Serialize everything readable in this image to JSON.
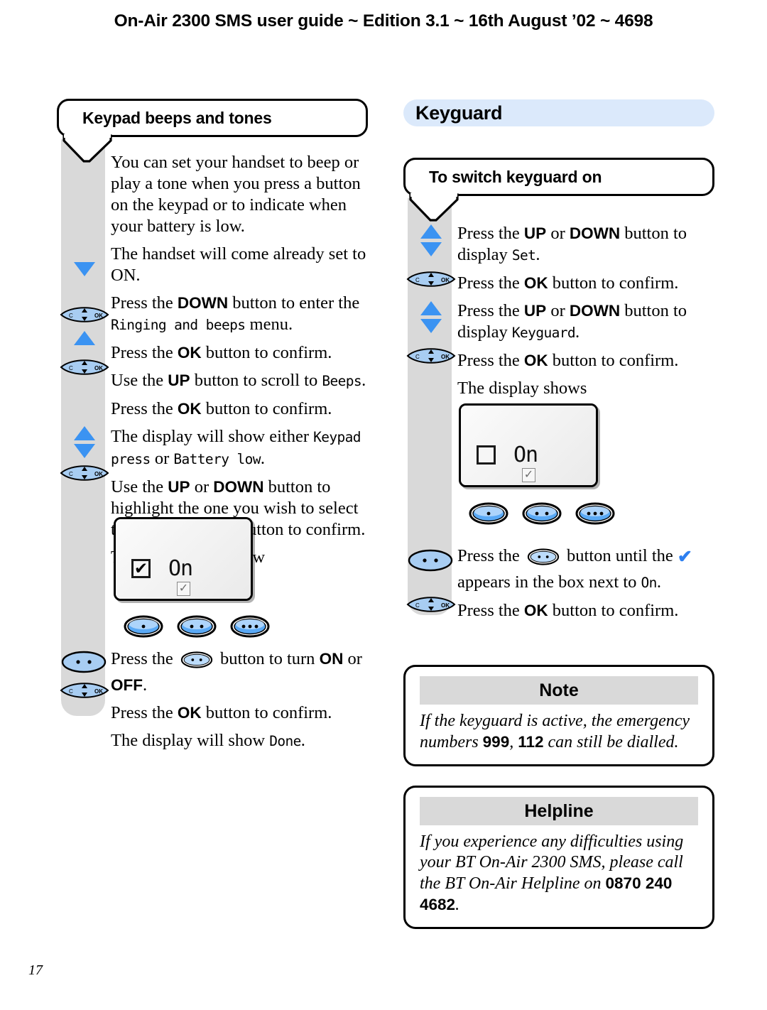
{
  "header": {
    "running_head": "On-Air 2300 SMS user guide ~ Edition 3.1 ~ 16th August ’02 ~ 4698",
    "page_number": "17"
  },
  "colors": {
    "section_bar": "#dbe9fb",
    "spine_grey": "#d9d9d9",
    "arrow_blue": "#3b93f2",
    "key_blue": "#a8cdf2",
    "tick_blue": "#2d7ff0",
    "infobox_bar": "#d9d9d9"
  },
  "left_column": {
    "heading": "Keypad beeps and tones",
    "steps": [
      {
        "icon": "none",
        "parts": [
          {
            "t": "plain",
            "v": "You can set your handset to beep or play a tone when you press a button on the keypad or to indicate when your battery is low."
          }
        ]
      },
      {
        "icon": "none",
        "parts": [
          {
            "t": "plain",
            "v": "The handset will come already set to ON."
          }
        ]
      },
      {
        "icon": "down-arrow",
        "parts": [
          {
            "t": "plain",
            "v": "Press the "
          },
          {
            "t": "bold",
            "v": "DOWN"
          },
          {
            "t": "plain",
            "v": " button to enter the "
          },
          {
            "t": "lcd",
            "v": "Ringing and beeps"
          },
          {
            "t": "plain",
            "v": " menu."
          }
        ]
      },
      {
        "icon": "nav-key",
        "parts": [
          {
            "t": "plain",
            "v": "Press the "
          },
          {
            "t": "bold",
            "v": "OK"
          },
          {
            "t": "plain",
            "v": " button to confirm."
          }
        ]
      },
      {
        "icon": "up-arrow",
        "parts": [
          {
            "t": "plain",
            "v": "Use the "
          },
          {
            "t": "bold",
            "v": "UP"
          },
          {
            "t": "plain",
            "v": " button to scroll to "
          },
          {
            "t": "lcd",
            "v": "Beeps"
          },
          {
            "t": "plain",
            "v": "."
          }
        ]
      },
      {
        "icon": "nav-key",
        "parts": [
          {
            "t": "plain",
            "v": "Press the "
          },
          {
            "t": "bold",
            "v": "OK"
          },
          {
            "t": "plain",
            "v": " button to confirm."
          }
        ]
      },
      {
        "icon": "none",
        "parts": [
          {
            "t": "plain",
            "v": "The display will show either "
          },
          {
            "t": "lcd",
            "v": "Keypad press"
          },
          {
            "t": "plain",
            "v": " or "
          },
          {
            "t": "lcd",
            "v": "Battery low"
          },
          {
            "t": "plain",
            "v": "."
          }
        ]
      },
      {
        "icon": "up-down-nav",
        "parts": [
          {
            "t": "plain",
            "v": "Use the "
          },
          {
            "t": "bold",
            "v": "UP"
          },
          {
            "t": "plain",
            "v": " or "
          },
          {
            "t": "bold",
            "v": "DOWN"
          },
          {
            "t": "plain",
            "v": " button to highlight the one you wish to select then press the "
          },
          {
            "t": "bold",
            "v": "OK"
          },
          {
            "t": "plain",
            "v": " button to confirm."
          }
        ]
      },
      {
        "icon": "none",
        "parts": [
          {
            "t": "plain",
            "v": "The display will show"
          }
        ]
      }
    ],
    "lcd": {
      "checkbox_state": "checked",
      "checkbox_glyph": "✔",
      "value": "On",
      "secondary_checkbox_glyph": "✓"
    },
    "keyrow": [
      {
        "name": "softkey-1-dot",
        "dots": 1
      },
      {
        "name": "softkey-2-dot",
        "dots": 2
      },
      {
        "name": "softkey-3-dot",
        "dots": 3
      }
    ],
    "steps_after": [
      {
        "icon": "soft-key-2dot",
        "parts": [
          {
            "t": "plain",
            "v": "Press the "
          },
          {
            "t": "inline-softkey",
            "v": "2"
          },
          {
            "t": "plain",
            "v": " button to turn "
          },
          {
            "t": "bold",
            "v": "ON"
          },
          {
            "t": "plain",
            "v": " or "
          },
          {
            "t": "bold",
            "v": "OFF"
          },
          {
            "t": "plain",
            "v": "."
          }
        ]
      },
      {
        "icon": "nav-key",
        "parts": [
          {
            "t": "plain",
            "v": "Press the "
          },
          {
            "t": "bold",
            "v": "OK"
          },
          {
            "t": "plain",
            "v": " button to confirm."
          }
        ]
      },
      {
        "icon": "none",
        "parts": [
          {
            "t": "plain",
            "v": "The display will show "
          },
          {
            "t": "lcd",
            "v": "Done"
          },
          {
            "t": "plain",
            "v": "."
          }
        ]
      }
    ]
  },
  "right_column": {
    "section_title": "Keyguard",
    "heading": "To switch keyguard on",
    "steps": [
      {
        "icon": "up-down-arrow",
        "parts": [
          {
            "t": "plain",
            "v": "Press the "
          },
          {
            "t": "bold",
            "v": "UP"
          },
          {
            "t": "plain",
            "v": " or "
          },
          {
            "t": "bold",
            "v": "DOWN"
          },
          {
            "t": "plain",
            "v": " button to display "
          },
          {
            "t": "lcd",
            "v": "Set"
          },
          {
            "t": "plain",
            "v": "."
          }
        ]
      },
      {
        "icon": "nav-key",
        "parts": [
          {
            "t": "plain",
            "v": "Press the "
          },
          {
            "t": "bold",
            "v": "OK"
          },
          {
            "t": "plain",
            "v": " button to confirm."
          }
        ]
      },
      {
        "icon": "up-down-arrow",
        "parts": [
          {
            "t": "plain",
            "v": "Press the "
          },
          {
            "t": "bold",
            "v": "UP"
          },
          {
            "t": "plain",
            "v": " or "
          },
          {
            "t": "bold",
            "v": "DOWN"
          },
          {
            "t": "plain",
            "v": " button to display "
          },
          {
            "t": "lcd",
            "v": "Keyguard"
          },
          {
            "t": "plain",
            "v": "."
          }
        ]
      },
      {
        "icon": "nav-key",
        "parts": [
          {
            "t": "plain",
            "v": "Press the "
          },
          {
            "t": "bold",
            "v": "OK"
          },
          {
            "t": "plain",
            "v": " button to confirm."
          }
        ]
      },
      {
        "icon": "none",
        "parts": [
          {
            "t": "plain",
            "v": "The display shows"
          }
        ]
      }
    ],
    "lcd": {
      "checkbox_state": "empty",
      "checkbox_glyph": "",
      "value": "On",
      "secondary_checkbox_glyph": "✓"
    },
    "keyrow": [
      {
        "name": "softkey-1-dot",
        "dots": 1
      },
      {
        "name": "softkey-2-dot",
        "dots": 2
      },
      {
        "name": "softkey-3-dot",
        "dots": 3
      }
    ],
    "steps_after": [
      {
        "icon": "soft-key-2dot",
        "parts": [
          {
            "t": "plain",
            "v": "Press the "
          },
          {
            "t": "inline-softkey",
            "v": "2"
          },
          {
            "t": "plain",
            "v": " button until the "
          },
          {
            "t": "tick",
            "v": "✔"
          },
          {
            "t": "plain",
            "v": " appears in the box next to "
          },
          {
            "t": "lcd",
            "v": "On"
          },
          {
            "t": "plain",
            "v": "."
          }
        ]
      },
      {
        "icon": "nav-key",
        "parts": [
          {
            "t": "plain",
            "v": "Press the "
          },
          {
            "t": "bold",
            "v": "OK"
          },
          {
            "t": "plain",
            "v": " button to confirm."
          }
        ]
      }
    ],
    "note_box": {
      "title": "Note",
      "parts": [
        {
          "t": "plain",
          "v": "If the keyguard is active, the emergency numbers "
        },
        {
          "t": "bold",
          "v": "999"
        },
        {
          "t": "plain",
          "v": ", "
        },
        {
          "t": "bold",
          "v": "112"
        },
        {
          "t": "plain",
          "v": " can still be dialled."
        }
      ]
    },
    "helpline_box": {
      "title": "Helpline",
      "parts": [
        {
          "t": "plain",
          "v": "If you experience any difficulties using your BT On-Air 2300 SMS, please call the BT On-Air Helpline on "
        },
        {
          "t": "bold",
          "v": "0870 240 4682"
        },
        {
          "t": "plain",
          "v": "."
        }
      ]
    }
  },
  "icon_names": {
    "up_arrow": "up-arrow-icon",
    "down_arrow": "down-arrow-icon",
    "nav_key": "navigation-key-icon",
    "soft_key": "soft-key-icon",
    "tick": "blue-tick-icon"
  }
}
